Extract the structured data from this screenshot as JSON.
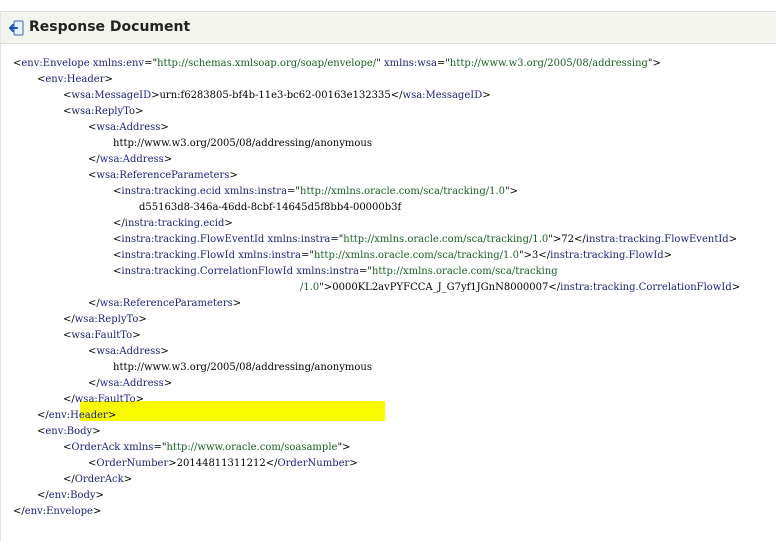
{
  "header": {
    "title": "Response Document",
    "icon": "return-arrow-icon"
  },
  "xml_lines": [
    {
      "indent": 0,
      "parts": [
        [
          "p",
          "<"
        ],
        [
          "t",
          "env:Envelope"
        ],
        [
          "p",
          " "
        ],
        [
          "a",
          "xmlns:env"
        ],
        [
          "p",
          "=\""
        ],
        [
          "v",
          "http://schemas.xmlsoap.org/soap/envelope/"
        ],
        [
          "p",
          "\" "
        ],
        [
          "a",
          "xmlns:wsa"
        ],
        [
          "p",
          "=\""
        ],
        [
          "v",
          "http://www.w3.org/2005/08/addressing"
        ],
        [
          "p",
          "\">"
        ]
      ]
    },
    {
      "indent": 1,
      "parts": [
        [
          "p",
          "<"
        ],
        [
          "t",
          "env:Header"
        ],
        [
          "p",
          ">"
        ]
      ]
    },
    {
      "indent": 2,
      "parts": [
        [
          "p",
          "<"
        ],
        [
          "t",
          "wsa:MessageID"
        ],
        [
          "p",
          ">urn:f6283805-bf4b-11e3-bc62-00163e132335</"
        ],
        [
          "t",
          "wsa:MessageID"
        ],
        [
          "p",
          ">"
        ]
      ]
    },
    {
      "indent": 2,
      "parts": [
        [
          "p",
          "<"
        ],
        [
          "t",
          "wsa:ReplyTo"
        ],
        [
          "p",
          ">"
        ]
      ]
    },
    {
      "indent": 3,
      "parts": [
        [
          "p",
          "<"
        ],
        [
          "t",
          "wsa:Address"
        ],
        [
          "p",
          ">"
        ]
      ]
    },
    {
      "indent": 4,
      "parts": [
        [
          "p",
          "http://www.w3.org/2005/08/addressing/anonymous"
        ]
      ]
    },
    {
      "indent": 3,
      "parts": [
        [
          "p",
          "</"
        ],
        [
          "t",
          "wsa:Address"
        ],
        [
          "p",
          ">"
        ]
      ]
    },
    {
      "indent": 3,
      "parts": [
        [
          "p",
          "<"
        ],
        [
          "t",
          "wsa:ReferenceParameters"
        ],
        [
          "p",
          ">"
        ]
      ]
    },
    {
      "indent": 4,
      "parts": [
        [
          "p",
          "<"
        ],
        [
          "t",
          "instra:tracking.ecid"
        ],
        [
          "p",
          " "
        ],
        [
          "a",
          "xmlns:instra"
        ],
        [
          "p",
          "=\""
        ],
        [
          "v",
          "http://xmlns.oracle.com/sca/tracking/1.0"
        ],
        [
          "p",
          "\">"
        ]
      ]
    },
    {
      "indent": 5,
      "parts": [
        [
          "p",
          "d55163d8-346a-46dd-8cbf-14645d5f8bb4-00000b3f"
        ]
      ]
    },
    {
      "indent": 4,
      "parts": [
        [
          "p",
          "</"
        ],
        [
          "t",
          "instra:tracking.ecid"
        ],
        [
          "p",
          ">"
        ]
      ]
    },
    {
      "indent": 4,
      "parts": [
        [
          "p",
          "<"
        ],
        [
          "t",
          "instra:tracking.FlowEventId"
        ],
        [
          "p",
          " "
        ],
        [
          "a",
          "xmlns:instra"
        ],
        [
          "p",
          "=\""
        ],
        [
          "v",
          "http://xmlns.oracle.com/sca/tracking/1.0"
        ],
        [
          "p",
          "\">72</"
        ],
        [
          "t",
          "instra:tracking.FlowEventId"
        ],
        [
          "p",
          ">"
        ]
      ]
    },
    {
      "indent": 4,
      "parts": [
        [
          "p",
          "<"
        ],
        [
          "t",
          "instra:tracking.FlowId"
        ],
        [
          "p",
          " "
        ],
        [
          "a",
          "xmlns:instra"
        ],
        [
          "p",
          "=\""
        ],
        [
          "v",
          "http://xmlns.oracle.com/sca/tracking/1.0"
        ],
        [
          "p",
          "\">3</"
        ],
        [
          "t",
          "instra:tracking.FlowId"
        ],
        [
          "p",
          ">"
        ]
      ]
    },
    {
      "indent": 4,
      "parts": [
        [
          "p",
          "<"
        ],
        [
          "t",
          "instra:tracking.CorrelationFlowId"
        ],
        [
          "p",
          " "
        ],
        [
          "a",
          "xmlns:instra"
        ],
        [
          "p",
          "=\""
        ],
        [
          "v",
          "http://xmlns.oracle.com/sca/tracking"
        ],
        [
          "p",
          ""
        ]
      ]
    },
    {
      "indent": 6,
      "parts": [
        [
          "v",
          "/1.0"
        ],
        [
          "p",
          "\">0000KL2avPYFCCA_J_G7yf1JGnN8000007</"
        ],
        [
          "t",
          "instra:tracking.CorrelationFlowId"
        ],
        [
          "p",
          ">"
        ]
      ]
    },
    {
      "indent": 3,
      "parts": [
        [
          "p",
          "</"
        ],
        [
          "t",
          "wsa:ReferenceParameters"
        ],
        [
          "p",
          ">"
        ]
      ]
    },
    {
      "indent": 2,
      "parts": [
        [
          "p",
          "</"
        ],
        [
          "t",
          "wsa:ReplyTo"
        ],
        [
          "p",
          ">"
        ]
      ]
    },
    {
      "indent": 2,
      "parts": [
        [
          "p",
          "<"
        ],
        [
          "t",
          "wsa:FaultTo"
        ],
        [
          "p",
          ">"
        ]
      ]
    },
    {
      "indent": 3,
      "parts": [
        [
          "p",
          "<"
        ],
        [
          "t",
          "wsa:Address"
        ],
        [
          "p",
          ">"
        ]
      ]
    },
    {
      "indent": 4,
      "parts": [
        [
          "p",
          "http://www.w3.org/2005/08/addressing/anonymous"
        ]
      ]
    },
    {
      "indent": 3,
      "parts": [
        [
          "p",
          "</"
        ],
        [
          "t",
          "wsa:Address"
        ],
        [
          "p",
          ">"
        ]
      ]
    },
    {
      "indent": 2,
      "parts": [
        [
          "p",
          "</"
        ],
        [
          "t",
          "wsa:FaultTo"
        ],
        [
          "p",
          ">"
        ]
      ]
    },
    {
      "indent": 1,
      "parts": [
        [
          "p",
          "</"
        ],
        [
          "t",
          "env:Header"
        ],
        [
          "p",
          ">"
        ]
      ]
    },
    {
      "indent": 1,
      "parts": [
        [
          "p",
          "<"
        ],
        [
          "t",
          "env:Body"
        ],
        [
          "p",
          ">"
        ]
      ]
    },
    {
      "indent": 2,
      "parts": [
        [
          "p",
          "<"
        ],
        [
          "t",
          "OrderAck"
        ],
        [
          "p",
          " "
        ],
        [
          "a",
          "xmlns"
        ],
        [
          "p",
          "=\""
        ],
        [
          "v",
          "http://www.oracle.com/soasample"
        ],
        [
          "p",
          "\">"
        ]
      ]
    },
    {
      "indent": 3,
      "highlight": true,
      "parts": [
        [
          "p",
          "<"
        ],
        [
          "t",
          "OrderNumber"
        ],
        [
          "p",
          ">20144811311212</"
        ],
        [
          "t",
          "OrderNumber"
        ],
        [
          "p",
          ">"
        ]
      ]
    },
    {
      "indent": 2,
      "parts": [
        [
          "p",
          "</"
        ],
        [
          "t",
          "OrderAck"
        ],
        [
          "p",
          ">"
        ]
      ]
    },
    {
      "indent": 1,
      "parts": [
        [
          "p",
          "</"
        ],
        [
          "t",
          "env:Body"
        ],
        [
          "p",
          ">"
        ]
      ]
    },
    {
      "indent": 0,
      "parts": [
        [
          "p",
          "</"
        ],
        [
          "t",
          "env:Envelope"
        ],
        [
          "p",
          ">"
        ]
      ]
    }
  ],
  "colors": {
    "tag": "#1a237e",
    "attr": "#1a237e",
    "value": "#1b5e20",
    "highlight": "#fafa00",
    "header_bg": "#f4f4ee"
  }
}
